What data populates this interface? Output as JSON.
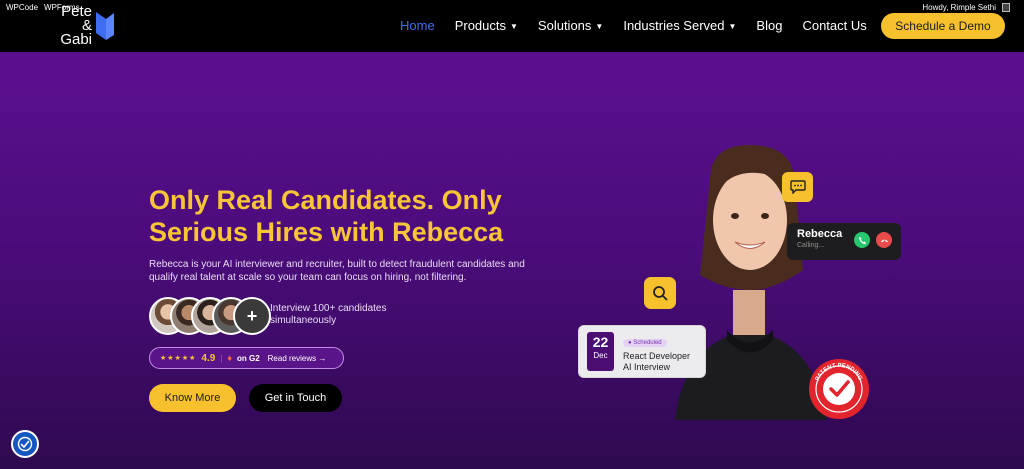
{
  "admin_bar": {
    "left_items": [
      "WPCode",
      "WPForms"
    ],
    "greeting": "Howdy, Rimple Sethi"
  },
  "header": {
    "logo_line1": "Pete &",
    "logo_line2": "Gabi",
    "nav": [
      {
        "label": "Home",
        "active": true,
        "dropdown": false
      },
      {
        "label": "Products",
        "active": false,
        "dropdown": true
      },
      {
        "label": "Solutions",
        "active": false,
        "dropdown": true
      },
      {
        "label": "Industries Served",
        "active": false,
        "dropdown": true
      },
      {
        "label": "Blog",
        "active": false,
        "dropdown": false
      },
      {
        "label": "Contact Us",
        "active": false,
        "dropdown": false
      }
    ],
    "cta_label": "Schedule a Demo"
  },
  "hero": {
    "headline_line1": "Only Real Candidates. Only",
    "headline_line2": "Serious Hires with Rebecca",
    "description": "Rebecca is your AI interviewer and recruiter, built to detect fraudulent candidates and qualify real talent at scale so your team can focus on hiring, not filtering.",
    "interview_line1": "Interview 100+ candidates",
    "interview_line2": "simultaneously",
    "faces_plus": "+",
    "rating": {
      "stars": "★★★★★",
      "score": "4.9",
      "platform": "on G2",
      "reviews_link": "Read reviews →"
    },
    "primary_button": "Know More",
    "secondary_button": "Get in Touch"
  },
  "illustration": {
    "call_card": {
      "name": "Rebecca",
      "status": "Calling..."
    },
    "schedule_card": {
      "day": "22",
      "month": "Dec",
      "badge": "● Scheduled",
      "title_line1": "React Developer",
      "title_line2": "AI Interview"
    },
    "seal_text": "PATENT PENDING"
  },
  "colors": {
    "accent_yellow": "#f7c12e",
    "nav_active": "#3f6df2",
    "hero_purple": "#5b0f8f"
  },
  "icons": [
    "chat-icon",
    "search-icon",
    "phone-accept-icon",
    "phone-decline-icon",
    "checkmark-seal-icon",
    "accessibility-icon"
  ]
}
